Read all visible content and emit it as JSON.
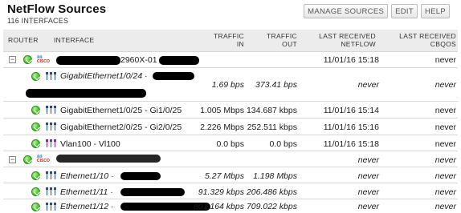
{
  "page": {
    "title": "NetFlow Sources",
    "subtitle": "116 INTERFACES"
  },
  "toolbar": {
    "manage_sources": "MANAGE SOURCES",
    "edit": "EDIT",
    "help": "HELP"
  },
  "columns": {
    "router": "ROUTER",
    "interface": "INTERFACE",
    "traffic_in": "TRAFFIC\nIN",
    "traffic_in_l1": "TRAFFIC",
    "traffic_in_l2": "IN",
    "traffic_out_l1": "TRAFFIC",
    "traffic_out_l2": "OUT",
    "netflow_l1": "LAST RECEIVED",
    "netflow_l2": "NETFLOW",
    "cbqos_l1": "LAST RECEIVED",
    "cbqos_l2": "CBQOS"
  },
  "nodes": [
    {
      "name_visible": "2960X-01",
      "last_netflow": "11/01/16 15:18",
      "last_cbqos": "never",
      "interfaces": [
        {
          "name": "GigabitEthernet1/0/24 ·",
          "in": "1.69 bps",
          "out": "373.41 bps",
          "netflow": "never",
          "cbqos": "never",
          "italic": true
        },
        {
          "name": "GigabitEthernet1/0/25 - Gi1/0/25",
          "in": "1.005 Mbps",
          "out": "134.687 kbps",
          "netflow": "11/01/16 15:14",
          "cbqos": "never",
          "italic": false
        },
        {
          "name": "GigabitEthernet2/0/25 - Gi2/0/25",
          "in": "2.226 Mbps",
          "out": "252.511 kbps",
          "netflow": "11/01/16 15:16",
          "cbqos": "never",
          "italic": false
        },
        {
          "name": "Vlan100 - Vl100",
          "in": "0.0 bps",
          "out": "0.0 bps",
          "netflow": "11/01/16 15:18",
          "cbqos": "never",
          "italic": false
        }
      ]
    },
    {
      "name_visible": "",
      "last_netflow": "never",
      "last_cbqos": "never",
      "interfaces": [
        {
          "name": "Ethernet1/10 ·",
          "in": "5.27 Mbps",
          "out": "1.198 Mbps",
          "netflow": "never",
          "cbqos": "never",
          "italic": true
        },
        {
          "name": "Ethernet1/11 ·",
          "in": "91.329 kbps",
          "out": "206.486 kbps",
          "netflow": "never",
          "cbqos": "never",
          "italic": true
        },
        {
          "name": "Ethernet1/12 ·",
          "in": "801.164 kbps",
          "out": "709.022 kbps",
          "netflow": "never",
          "cbqos": "never",
          "italic": true
        }
      ]
    }
  ],
  "icons": {
    "status": "green-check-icon",
    "router": "cisco-router-icon",
    "interface": "interface-icon",
    "expand": "minus-expander-icon"
  },
  "colors": {
    "status_green": "#4cc22f",
    "header_bg": "#ececec",
    "vlan_icon": "#7b2ea3",
    "iface_icon": "#2a4d8f"
  }
}
